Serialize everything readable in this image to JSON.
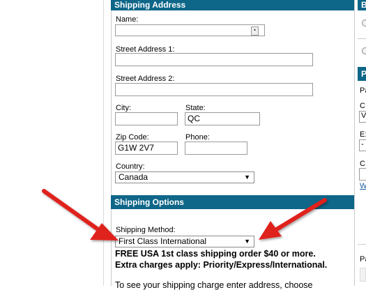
{
  "shipping_address": {
    "title": "Shipping Address",
    "name_label": "Name:",
    "name_value": "",
    "street1_label": "Street Address 1:",
    "street1_value": "",
    "street2_label": "Street Address 2:",
    "street2_value": "",
    "city_label": "City:",
    "city_value": "",
    "state_label": "State:",
    "state_value": "QC",
    "zip_label": "Zip Code:",
    "zip_value": "G1W 2V7",
    "phone_label": "Phone:",
    "phone_value": "",
    "country_label": "Country:",
    "country_value": "Canada"
  },
  "shipping_options": {
    "title": "Shipping Options",
    "method_label": "Shipping Method:",
    "method_value": "First Class International",
    "note_line1": "FREE USA 1st class shipping order $40 or more.",
    "note_line2": "Extra charges apply: Priority/Express/International.",
    "note_line3": "To see your shipping charge enter address, choose"
  },
  "right_column": {
    "header1": "B",
    "header2": "P",
    "row1": "Pa",
    "row2": "C",
    "row2_value": "V",
    "row3": "E:",
    "row3_value": "-",
    "row4": "C",
    "row5": "W",
    "row6": "Pa"
  },
  "colors": {
    "header_bg": "#0e6688",
    "arrow_red": "#e0201b"
  }
}
